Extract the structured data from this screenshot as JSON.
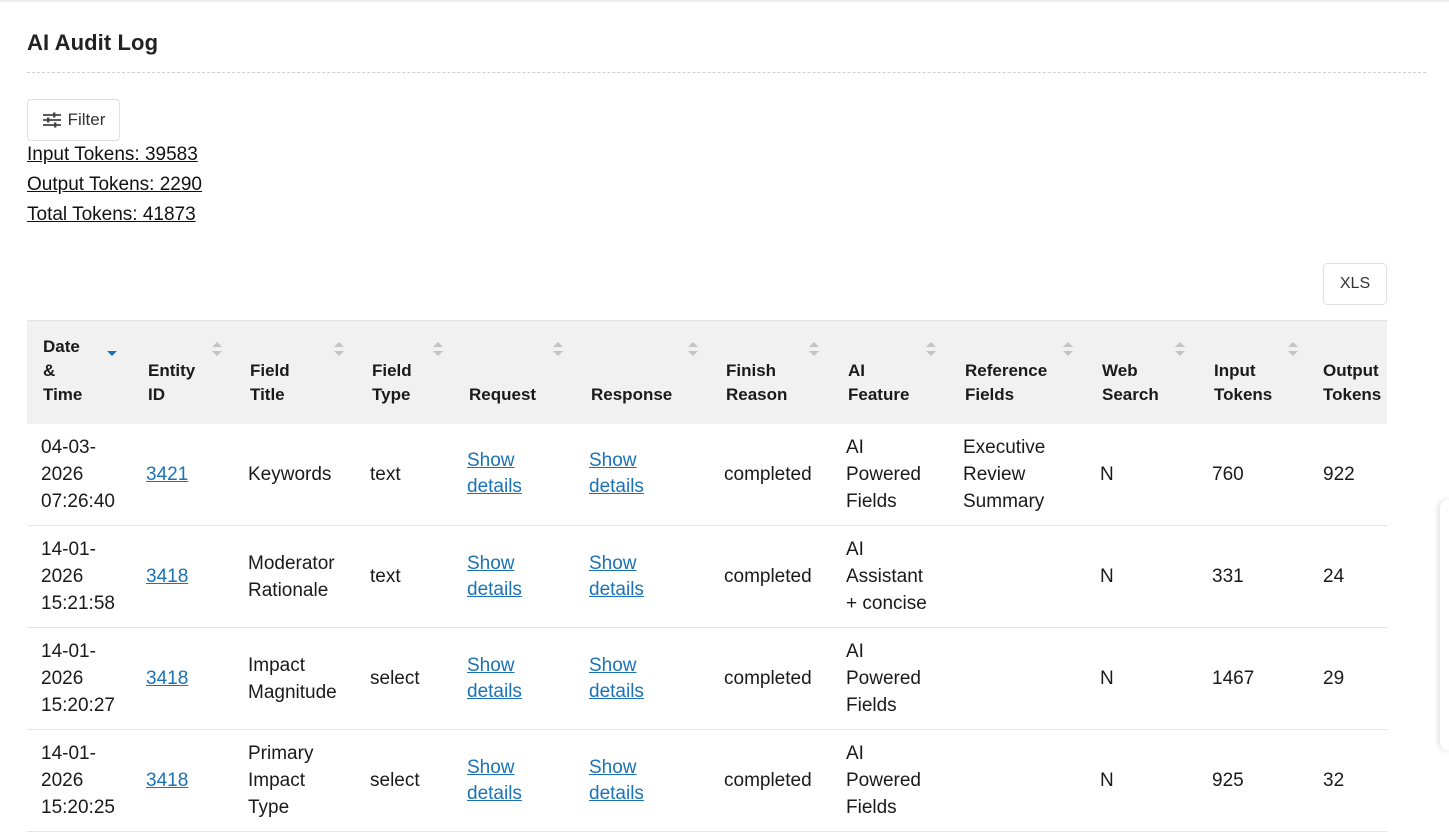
{
  "page": {
    "title": "AI Audit Log"
  },
  "toolbar": {
    "filter_label": "Filter",
    "filter_icon": "sliders-icon",
    "export_label": "XLS"
  },
  "tokens": {
    "input": "Input Tokens: 39583",
    "output": "Output Tokens: 2290",
    "total": "Total Tokens: 41873"
  },
  "table": {
    "sort": {
      "column": "date_time",
      "direction": "descending"
    },
    "columns": [
      {
        "key": "date_time",
        "line1": "Date",
        "line2": "&",
        "line3": "Time"
      },
      {
        "key": "entity_id",
        "line1": "Entity",
        "line2": "ID"
      },
      {
        "key": "field_title",
        "line1": "Field",
        "line2": "Title"
      },
      {
        "key": "field_type",
        "line1": "Field",
        "line2": "Type"
      },
      {
        "key": "request",
        "line1": "Request"
      },
      {
        "key": "response",
        "line1": "Response"
      },
      {
        "key": "finish_reason",
        "line1": "Finish",
        "line2": "Reason"
      },
      {
        "key": "ai_feature",
        "line1": "AI",
        "line2": "Feature"
      },
      {
        "key": "reference_fields",
        "line1": "Reference",
        "line2": "Fields"
      },
      {
        "key": "web_search",
        "line1": "Web",
        "line2": "Search"
      },
      {
        "key": "input_tokens",
        "line1": "Input",
        "line2": "Tokens"
      },
      {
        "key": "output_tokens",
        "line1": "Output",
        "line2": "Tokens"
      }
    ],
    "rows": [
      {
        "date": "04-03-",
        "year": "2026",
        "time": "07:26:40",
        "entity_id": "3421",
        "field_title": [
          "Keywords"
        ],
        "field_type": "text",
        "request": [
          "Show",
          "details"
        ],
        "response": [
          "Show",
          "details"
        ],
        "finish_reason": "completed",
        "ai_feature": [
          "AI",
          "Powered",
          "Fields"
        ],
        "reference_fields": [
          "Executive",
          "Review",
          "Summary"
        ],
        "web_search": "N",
        "input_tokens": "760",
        "output_tokens": "922"
      },
      {
        "date": "14-01-",
        "year": "2026",
        "time": "15:21:58",
        "entity_id": "3418",
        "field_title": [
          "Moderator",
          "Rationale"
        ],
        "field_type": "text",
        "request": [
          "Show",
          "details"
        ],
        "response": [
          "Show",
          "details"
        ],
        "finish_reason": "completed",
        "ai_feature": [
          "AI",
          "Assistant",
          "+ concise"
        ],
        "reference_fields": [],
        "web_search": "N",
        "input_tokens": "331",
        "output_tokens": "24"
      },
      {
        "date": "14-01-",
        "year": "2026",
        "time": "15:20:27",
        "entity_id": "3418",
        "field_title": [
          "Impact",
          "Magnitude"
        ],
        "field_type": "select",
        "request": [
          "Show",
          "details"
        ],
        "response": [
          "Show",
          "details"
        ],
        "finish_reason": "completed",
        "ai_feature": [
          "AI",
          "Powered",
          "Fields"
        ],
        "reference_fields": [],
        "web_search": "N",
        "input_tokens": "1467",
        "output_tokens": "29"
      },
      {
        "date": "14-01-",
        "year": "2026",
        "time": "15:20:25",
        "entity_id": "3418",
        "field_title": [
          "Primary",
          "Impact",
          "Type"
        ],
        "field_type": "select",
        "request": [
          "Show",
          "details"
        ],
        "response": [
          "Show",
          "details"
        ],
        "finish_reason": "completed",
        "ai_feature": [
          "AI",
          "Powered",
          "Fields"
        ],
        "reference_fields": [],
        "web_search": "N",
        "input_tokens": "925",
        "output_tokens": "32"
      }
    ]
  },
  "colors": {
    "link": "#1a73b6",
    "header_bg": "#f1f1f1",
    "sort_active": "#1a73b6",
    "sort_inactive": "#c4c4c4"
  }
}
